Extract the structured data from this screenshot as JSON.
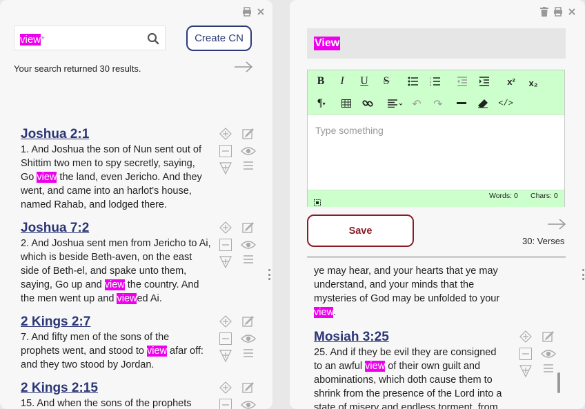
{
  "left": {
    "search": {
      "value_hit": "view",
      "value_rest": "*"
    },
    "create_button": "Create CN",
    "result_text": "Your search returned 30 results.",
    "verses": [
      {
        "title": "Joshua 2:1",
        "parts": [
          "1. And Joshua the son of Nun sent out of Shittim two men to spy secretly, saying, Go ",
          "view",
          " the land, even Jericho. And they went, and came into an harlot's house, named Rahab, and lodged there."
        ]
      },
      {
        "title": "Joshua 7:2",
        "parts": [
          "2. And Joshua sent men from Jericho to Ai, which is beside Beth-aven, on the east side of Beth-el, and spake unto them, saying, Go up and ",
          "view",
          " the country. And the men went up and ",
          "view",
          "ed Ai."
        ]
      },
      {
        "title": "2 Kings 2:7",
        "parts": [
          "7. And fifty men of the sons of the prophets went, and stood to ",
          "view",
          " afar off: and they two stood by Jordan."
        ]
      },
      {
        "title": "2 Kings 2:15",
        "parts": [
          "15. And when the sons of the prophets"
        ]
      }
    ]
  },
  "right": {
    "title": "View",
    "editor": {
      "placeholder": "Type something",
      "words": "Words: 0",
      "chars": "Chars: 0"
    },
    "save_button": "Save",
    "count": "30: Verses",
    "partial_text": [
      "ye may hear, and your hearts that ye may understand, and your minds that the mysteries of God may be unfolded to your ",
      "view",
      "."
    ],
    "verses": [
      {
        "title": "Mosiah 3:25",
        "parts": [
          "25. And if they be evil they are consigned to an awful ",
          "view",
          " of their own guilt and abominations, which doth cause them to shrink from the presence of the Lord into a state of misery and endless torment, from"
        ]
      }
    ]
  },
  "colors": {
    "highlight": "#ee00ee",
    "title": "#2a3577",
    "save": "#8b1c25",
    "toolbar": "#ccffcc"
  },
  "icons": [
    "print-icon",
    "close-icon",
    "trash-icon",
    "search-icon",
    "arrow-right-icon",
    "thumbs-up-icon",
    "edit-icon",
    "minus-icon",
    "eye-icon",
    "thumbs-down-icon",
    "menu-icon"
  ]
}
